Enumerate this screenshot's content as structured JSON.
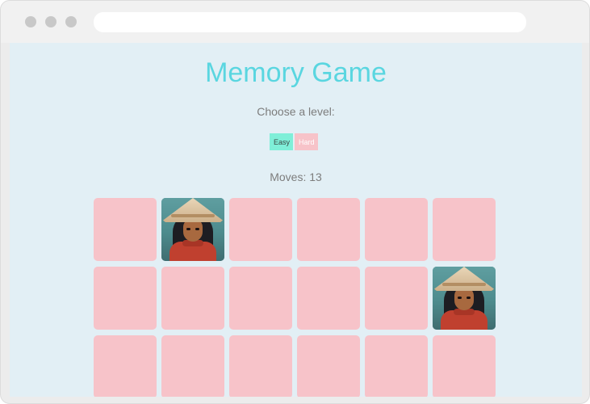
{
  "header": {
    "title": "Memory Game"
  },
  "level": {
    "label": "Choose a level:",
    "buttons": [
      {
        "label": "Easy",
        "color": "#7fefd8"
      },
      {
        "label": "Hard",
        "color": "#f7c3c9"
      }
    ]
  },
  "moves": {
    "label": "Moves: 13"
  },
  "board": {
    "columns": 6,
    "card_back_color": "#f7c3c9",
    "revealed_card_image": "character-with-straw-hat",
    "cards": [
      {
        "state": "hidden"
      },
      {
        "state": "revealed"
      },
      {
        "state": "hidden"
      },
      {
        "state": "hidden"
      },
      {
        "state": "hidden"
      },
      {
        "state": "hidden"
      },
      {
        "state": "hidden"
      },
      {
        "state": "hidden"
      },
      {
        "state": "hidden"
      },
      {
        "state": "hidden"
      },
      {
        "state": "hidden"
      },
      {
        "state": "revealed"
      },
      {
        "state": "hidden"
      },
      {
        "state": "hidden"
      },
      {
        "state": "hidden"
      },
      {
        "state": "hidden"
      },
      {
        "state": "hidden"
      },
      {
        "state": "hidden"
      }
    ]
  },
  "colors": {
    "title": "#5ad6e0",
    "background": "#e2eff5",
    "text": "#7d7d7d"
  }
}
